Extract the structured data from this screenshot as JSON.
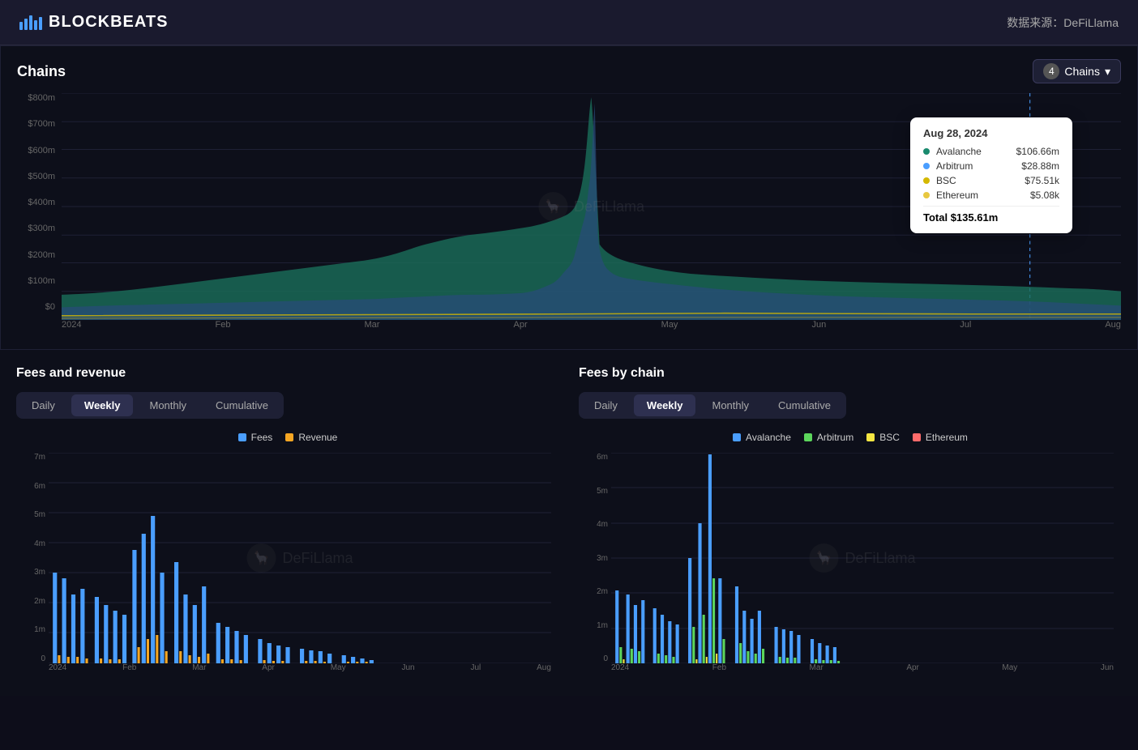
{
  "header": {
    "logo_text": "BLOCKBEATS",
    "source_label": "数据来源：DeFiLlama"
  },
  "main_chart": {
    "title": "Chains",
    "chains_button_label": "Chains",
    "chains_count": "4",
    "y_labels": [
      "$800m",
      "$700m",
      "$600m",
      "$500m",
      "$400m",
      "$300m",
      "$200m",
      "$100m",
      "$0"
    ],
    "x_labels": [
      "2024",
      "Feb",
      "Mar",
      "Apr",
      "May",
      "Jun",
      "Jul",
      "Aug"
    ],
    "tooltip": {
      "date": "Aug 28, 2024",
      "rows": [
        {
          "color": "#1a8a6e",
          "label": "Avalanche",
          "value": "$106.66m"
        },
        {
          "color": "#4a9eff",
          "label": "Arbitrum",
          "value": "$28.88m"
        },
        {
          "color": "#f0e060",
          "label": "BSC",
          "value": "$75.51k"
        },
        {
          "color": "#f0d060",
          "label": "Ethereum",
          "value": "$5.08k"
        }
      ],
      "total_label": "Total",
      "total_value": "$135.61m"
    }
  },
  "fees_revenue": {
    "title": "Fees and revenue",
    "tabs": [
      "Daily",
      "Weekly",
      "Monthly",
      "Cumulative"
    ],
    "active_tab": "Weekly",
    "legend": [
      {
        "label": "Fees",
        "color": "#4a9eff"
      },
      {
        "label": "Revenue",
        "color": "#f5a623"
      }
    ],
    "y_labels": [
      "7m",
      "6m",
      "5m",
      "4m",
      "3m",
      "2m",
      "1m",
      "0"
    ],
    "x_labels": [
      "2024",
      "Feb",
      "Mar",
      "Apr",
      "May",
      "Jun",
      "Jul",
      "Aug"
    ]
  },
  "fees_by_chain": {
    "title": "Fees by chain",
    "tabs": [
      "Daily",
      "Weekly",
      "Monthly",
      "Cumulative"
    ],
    "active_tab": "Weekly",
    "legend": [
      {
        "label": "Avalanche",
        "color": "#4a9eff"
      },
      {
        "label": "Arbitrum",
        "color": "#5cd65c"
      },
      {
        "label": "BSC",
        "color": "#f5e642"
      },
      {
        "label": "Ethereum",
        "color": "#ff6b6b"
      }
    ],
    "y_labels": [
      "6m",
      "5m",
      "4m",
      "3m",
      "2m",
      "1m",
      "0"
    ],
    "x_labels": [
      "2024",
      "Feb",
      "Mar",
      "Apr",
      "May",
      "Jun"
    ]
  }
}
